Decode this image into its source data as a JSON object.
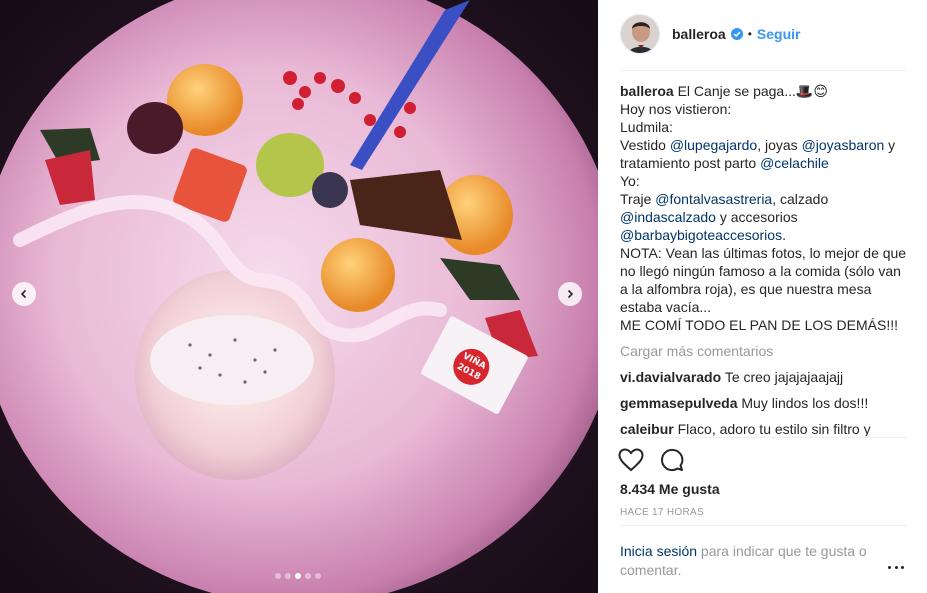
{
  "header": {
    "username": "balleroa",
    "follow_label": "Seguir",
    "separator": "•"
  },
  "caption": {
    "username": "balleroa",
    "line1": "El Canje se paga...🎩😊",
    "line2": "Hoy nos vistieron:",
    "line3": "Ludmila:",
    "l4_a": "Vestido ",
    "l4_m1": "@lupegajardo",
    "l4_b": ", joyas ",
    "l4_m2": "@joyasbaron",
    "l4_c": " y tratamiento post parto ",
    "l4_m3": "@celachile",
    "line5": "Yo:",
    "l6_a": "Traje ",
    "l6_m1": "@fontalvasastreria",
    "l6_b": ", calzado ",
    "l6_m2": "@indascalzado",
    "l6_c": " y accesorios ",
    "l6_m3": "@barbaybigoteaccesorios",
    "l6_d": ".",
    "nota": "NOTA: Vean las últimas fotos, lo mejor de que no llegó ningún famoso a la comida (sólo van a la alfombra roja), es que nuestra mesa estaba vacía...",
    "last": "ME COMÍ TODO EL PAN DE LOS DEMÁS!!!"
  },
  "load_more": "Cargar más comentarios",
  "comments": [
    {
      "user": "vi.davialvarado",
      "text": "Te creo jajajajaajajj"
    },
    {
      "user": "gemmasepulveda",
      "text": "Muy lindos los dos!!!"
    },
    {
      "user": "caleibur",
      "text": "Flaco, adoro tu estilo sin filtro y"
    }
  ],
  "likes": "8.434 Me gusta",
  "timestamp": "HACE 17 HORAS",
  "login": {
    "link": "Inicia sesión",
    "text": " para indicar que te gusta o comentar."
  },
  "media": {
    "plate_label": "VIÑA 2018",
    "carousel": {
      "count": 5,
      "active": 3
    }
  },
  "colors": {
    "link_blue": "#3897f0",
    "mention_blue": "#003569",
    "muted": "#999999",
    "text": "#262626"
  },
  "icons": [
    "chevron-left-icon",
    "chevron-right-icon",
    "verified-icon",
    "heart-icon",
    "comment-icon",
    "more-options-icon"
  ]
}
